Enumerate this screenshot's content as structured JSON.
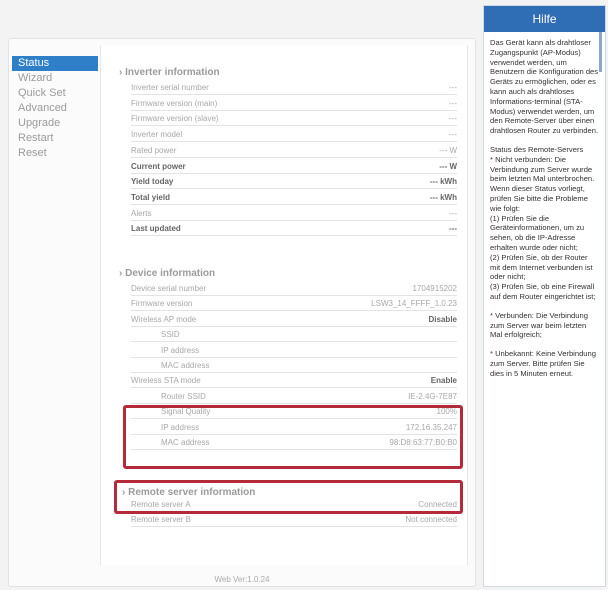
{
  "sidebar": {
    "items": [
      {
        "label": "Status",
        "active": true
      },
      {
        "label": "Wizard"
      },
      {
        "label": "Quick Set"
      },
      {
        "label": "Advanced"
      },
      {
        "label": "Upgrade"
      },
      {
        "label": "Restart"
      },
      {
        "label": "Reset"
      }
    ]
  },
  "inverter": {
    "title": "Inverter information",
    "rows": [
      {
        "label": "Inverter serial number",
        "value": "---"
      },
      {
        "label": "Firmware version (main)",
        "value": "---"
      },
      {
        "label": "Firmware version (slave)",
        "value": "---"
      },
      {
        "label": "Inverter model",
        "value": "---"
      },
      {
        "label": "Rated power",
        "value": "--- W"
      },
      {
        "label": "Current power",
        "value": "--- W",
        "bold": true
      },
      {
        "label": "Yield today",
        "value": "--- kWh",
        "bold": true
      },
      {
        "label": "Total yield",
        "value": "--- kWh",
        "bold": true
      },
      {
        "label": "Alerts",
        "value": "---"
      },
      {
        "label": "Last updated",
        "value": "---",
        "bold": true
      }
    ]
  },
  "device": {
    "title": "Device information",
    "rows": [
      {
        "label": "Device serial number",
        "value": "1704915202"
      },
      {
        "label": "Firmware version",
        "value": "LSW3_14_FFFF_1.0.23"
      },
      {
        "label": "Wireless AP mode",
        "value": "Disable",
        "bold_value": true
      },
      {
        "label": "SSID",
        "value": "",
        "sub": true
      },
      {
        "label": "IP address",
        "value": "",
        "sub": true
      },
      {
        "label": "MAC address",
        "value": "",
        "sub": true
      },
      {
        "label": "Wireless STA mode",
        "value": "Enable",
        "bold_value": true
      },
      {
        "label": "Router SSID",
        "value": "IE-2.4G-7E87",
        "sub": true
      },
      {
        "label": "Signal Quality",
        "value": "100%",
        "sub": true
      },
      {
        "label": "IP address",
        "value": "172.16.35.247",
        "sub": true
      },
      {
        "label": "MAC address",
        "value": "98:D8:63:77:B0:B0",
        "sub": true
      }
    ]
  },
  "remote": {
    "title": "Remote server information",
    "rows": [
      {
        "label": "Remote server A",
        "value": "Connected"
      },
      {
        "label": "Remote server B",
        "value": "Not connected"
      }
    ]
  },
  "footer": "Web Ver:1.0.24",
  "help": {
    "title": "Hilfe",
    "paragraphs": [
      "Das Gerät kann als drahtloser Zugangspunkt (AP-Modus) verwendet werden, um Benutzern die Konfiguration des Geräts zu ermöglichen, oder es kann auch als drahtloses Informations-terminal (STA-Modus) verwendet werden, um den Remote-Server über einen drahtlosen Router zu verbinden.",
      "Status des Remote-Servers\n* Nicht verbunden: Die Verbindung zum Server wurde beim letzten Mal unterbrochen. Wenn dieser Status vorliegt, prüfen Sie bitte die Probleme wie folgt:\n(1) Prüfen Sie die Geräteinformationen, um zu sehen, ob die IP-Adresse erhalten wurde oder nicht;\n(2) Prüfen Sie, ob der Router mit dem Internet verbunden ist oder nicht;\n(3) Prüfen Sie, ob eine Firewall auf dem Router eingerichtet ist;",
      "* Verbunden: Die Verbindung zum Server war beim letzten Mal erfolgreich;",
      "* Unbekannt: Keine Verbindung zum Server. Bitte prüfen Sie dies in 5 Minuten erneut."
    ]
  },
  "colors": {
    "accent": "#2f7fc8",
    "help_header": "#2f6db5",
    "highlight": "#b52a3a"
  }
}
